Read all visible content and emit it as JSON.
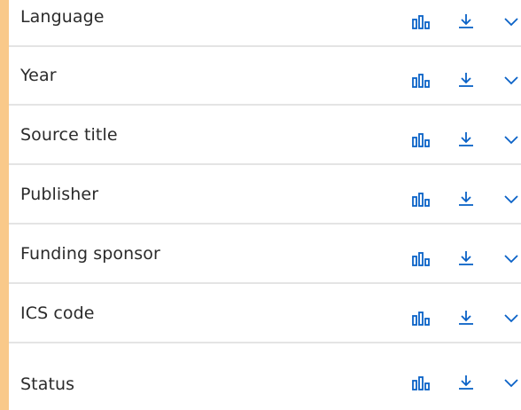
{
  "colors": {
    "accent": "#f9c98a",
    "icon": "#0a62c7",
    "divider": "#e4e4e4",
    "label": "#2b2b2b"
  },
  "filters": [
    {
      "label": "Language"
    },
    {
      "label": "Year"
    },
    {
      "label": "Source title"
    },
    {
      "label": "Publisher"
    },
    {
      "label": "Funding sponsor"
    },
    {
      "label": "ICS code"
    },
    {
      "label": "Status"
    }
  ],
  "icons": {
    "chart": "bar-chart-icon",
    "download": "download-icon",
    "expand": "chevron-down-icon"
  }
}
